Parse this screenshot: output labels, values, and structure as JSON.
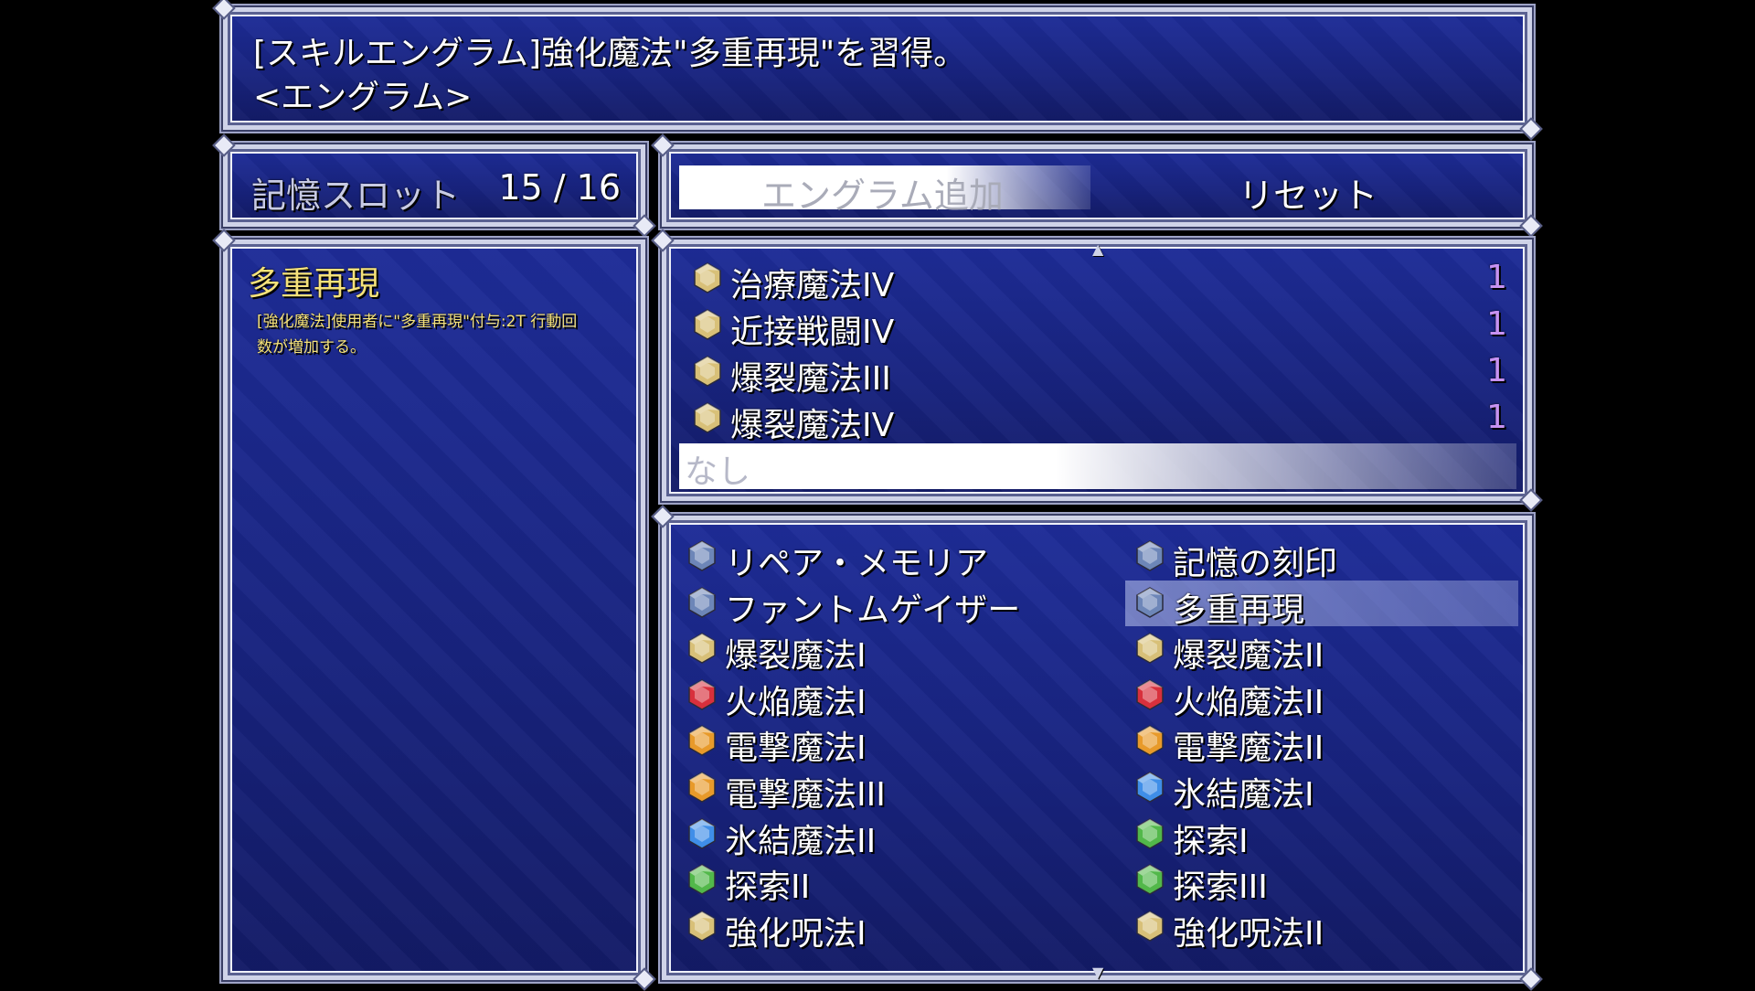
{
  "message": {
    "line1": "[スキルエングラム]強化魔法\"多重再現\"を習得。",
    "line2": "<エングラム>"
  },
  "slots": {
    "label": "記憶スロット",
    "value": "15 / 16"
  },
  "commands": {
    "add": "エングラム追加",
    "reset": "リセット"
  },
  "detail": {
    "title": "多重再現",
    "desc_line1": "[強化魔法]使用者に\"多重再現\"付与:2T 行動回",
    "desc_line2": "数が増加する。"
  },
  "equipped": [
    {
      "name": "治療魔法IV",
      "count": "1",
      "gem": "gold"
    },
    {
      "name": "近接戦闘IV",
      "count": "1",
      "gem": "gold"
    },
    {
      "name": "爆裂魔法III",
      "count": "1",
      "gem": "gold"
    },
    {
      "name": "爆裂魔法IV",
      "count": "1",
      "gem": "gold"
    },
    {
      "name": "なし"
    }
  ],
  "available": [
    {
      "name": "リペア・メモリア",
      "gem": "dark-blue"
    },
    {
      "name": "記憶の刻印",
      "gem": "dark-blue"
    },
    {
      "name": "ファントムゲイザー",
      "gem": "dark-blue"
    },
    {
      "name": "多重再現",
      "gem": "dark-blue",
      "selected": true
    },
    {
      "name": "爆裂魔法I",
      "gem": "gold"
    },
    {
      "name": "爆裂魔法II",
      "gem": "gold"
    },
    {
      "name": "火焔魔法I",
      "gem": "red"
    },
    {
      "name": "火焔魔法II",
      "gem": "red"
    },
    {
      "name": "電撃魔法I",
      "gem": "orange"
    },
    {
      "name": "電撃魔法II",
      "gem": "orange"
    },
    {
      "name": "電撃魔法III",
      "gem": "orange"
    },
    {
      "name": "氷結魔法I",
      "gem": "blue"
    },
    {
      "name": "氷結魔法II",
      "gem": "blue"
    },
    {
      "name": "探索I",
      "gem": "green"
    },
    {
      "name": "探索II",
      "gem": "green"
    },
    {
      "name": "探索III",
      "gem": "green"
    },
    {
      "name": "強化呪法I",
      "gem": "gold"
    },
    {
      "name": "強化呪法II",
      "gem": "gold"
    }
  ],
  "gem_colors": {
    "gold": "#d8c078",
    "dark-blue": "#6d86b8",
    "red": "#d8303c",
    "orange": "#e89a2a",
    "blue": "#3f8ee8",
    "green": "#52b84a"
  },
  "icons": {
    "gem": "engram-gem-icon",
    "scroll_up": "scroll-up-arrow-icon",
    "scroll_down": "scroll-down-arrow-icon"
  }
}
